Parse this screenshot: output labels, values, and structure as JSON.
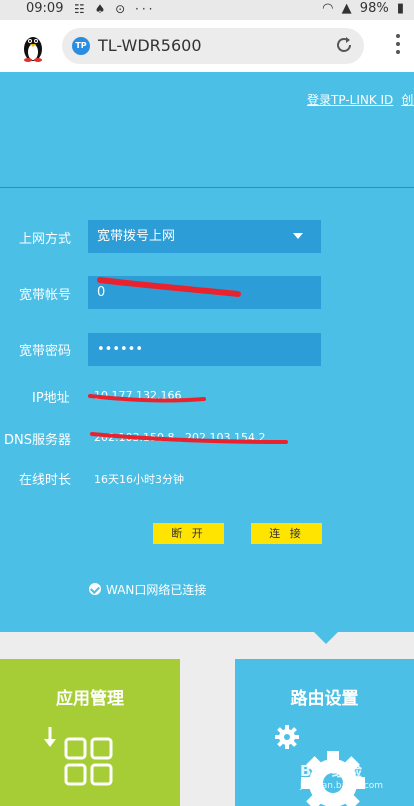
{
  "status_bar": {
    "time": "09:09",
    "icons": "☷ ♠ ⊙ ···",
    "battery": "98%"
  },
  "browser": {
    "url": "TL-WDR5600",
    "site_badge": "TP",
    "icons": [
      "reload-icon",
      "kebab-menu-icon",
      "tux-icon"
    ]
  },
  "header": {
    "login_link": "登录TP-LINK ID",
    "create_link": "创建"
  },
  "form": {
    "conn_type_label": "上网方式",
    "conn_type_value": "宽带拨号上网",
    "account_label": "宽带帐号",
    "account_value": "0",
    "password_label": "宽带密码",
    "password_value": "••••••",
    "ip_label": "IP地址",
    "ip_value": "10.177.132.166",
    "dns_label": "DNS服务器",
    "dns_value": "202.103.150.8 , 202.103.154.2",
    "uptime_label": "在线时长",
    "uptime_value": "16天16小时3分钟"
  },
  "buttons": {
    "disconnect": "断 开",
    "connect": "连 接"
  },
  "wan_status": "WAN口网络已连接",
  "tiles": {
    "app_mgmt": "应用管理",
    "router_settings": "路由设置"
  },
  "watermark": {
    "main": "Bai 经验",
    "sub": "jingyan.baidu.com"
  },
  "colors": {
    "main_bg": "#4bbfe6",
    "field_bg": "#2c9dd6",
    "button": "#ffe400",
    "app_tile": "#a6cd35",
    "redaction": "#e8232e"
  }
}
